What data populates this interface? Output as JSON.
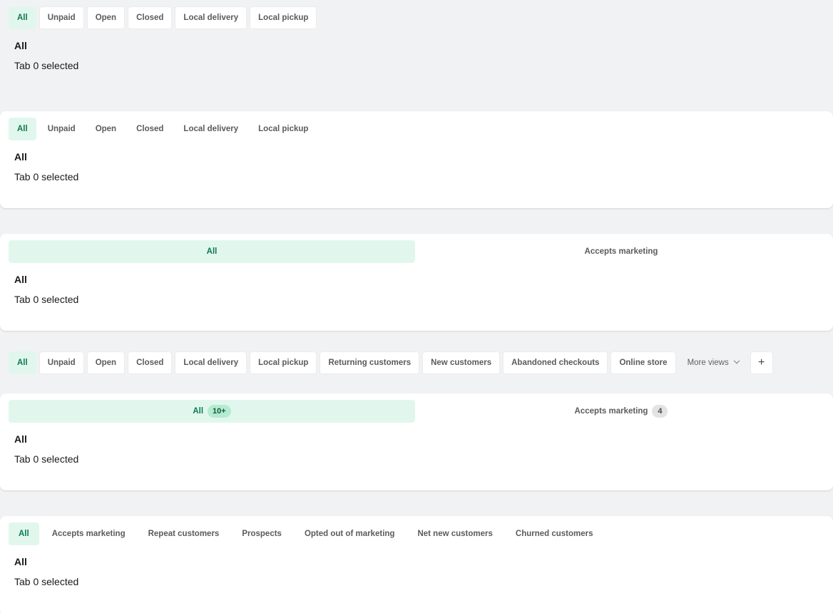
{
  "examples": [
    {
      "tabs": [
        "All",
        "Unpaid",
        "Open",
        "Closed",
        "Local delivery",
        "Local pickup"
      ],
      "panel": {
        "title": "All",
        "subtitle": "Tab 0 selected"
      }
    },
    {
      "tabs": [
        "All",
        "Unpaid",
        "Open",
        "Closed",
        "Local delivery",
        "Local pickup"
      ],
      "panel": {
        "title": "All",
        "subtitle": "Tab 0 selected"
      }
    },
    {
      "tabs": [
        "All",
        "Accepts marketing"
      ],
      "panel": {
        "title": "All",
        "subtitle": "Tab 0 selected"
      }
    },
    {
      "tabs": [
        "All",
        "Unpaid",
        "Open",
        "Closed",
        "Local delivery",
        "Local pickup",
        "Returning customers",
        "New customers",
        "Abandoned checkouts",
        "Online store"
      ],
      "more_views": "More views",
      "add": "+"
    },
    {
      "tabs": [
        {
          "label": "All",
          "badge": "10+"
        },
        {
          "label": "Accepts marketing",
          "badge": "4"
        }
      ],
      "panel": {
        "title": "All",
        "subtitle": "Tab 0 selected"
      }
    },
    {
      "tabs": [
        "All",
        "Accepts marketing",
        "Repeat customers",
        "Prospects",
        "Opted out of marketing",
        "Net new customers",
        "Churned customers"
      ],
      "panel": {
        "title": "All",
        "subtitle": "Tab 0 selected"
      }
    }
  ],
  "colors": {
    "active_bg": "#e1f7ed",
    "active_text": "#0d7a4d",
    "page_bg": "#f1f2f4"
  }
}
